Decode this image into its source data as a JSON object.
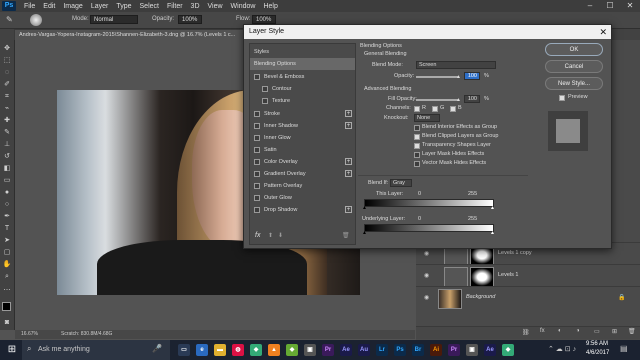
{
  "app": {
    "logo": "Ps"
  },
  "menubar": [
    "File",
    "Edit",
    "Image",
    "Layer",
    "Type",
    "Select",
    "Filter",
    "3D",
    "View",
    "Window",
    "Help"
  ],
  "options_bar": {
    "mode_label": "Mode:",
    "mode_value": "Normal",
    "opacity_label": "Opacity:",
    "opacity_value": "100%",
    "flow_label": "Flow:",
    "flow_value": "100%"
  },
  "document_tab": "Andres-Vargas-Yopera-Instagram-2015\\Shannen-Elizabeth-3.dng @ 16.7% (Levels 1 c...",
  "status": {
    "zoom": "16.67%",
    "scratch": "Scratch: 830.8M/4.68G"
  },
  "dialog": {
    "title": "Layer Style",
    "styles_header": "Styles",
    "items": [
      {
        "label": "Blending Options",
        "checkbox": false,
        "plus": false,
        "selected": true
      },
      {
        "label": "Bevel & Emboss",
        "checkbox": true,
        "plus": false
      },
      {
        "label": "Contour",
        "checkbox": true,
        "plus": false,
        "indent": true
      },
      {
        "label": "Texture",
        "checkbox": true,
        "plus": false,
        "indent": true
      },
      {
        "label": "Stroke",
        "checkbox": true,
        "plus": true
      },
      {
        "label": "Inner Shadow",
        "checkbox": true,
        "plus": true
      },
      {
        "label": "Inner Glow",
        "checkbox": true,
        "plus": false
      },
      {
        "label": "Satin",
        "checkbox": true,
        "plus": false
      },
      {
        "label": "Color Overlay",
        "checkbox": true,
        "plus": true
      },
      {
        "label": "Gradient Overlay",
        "checkbox": true,
        "plus": true
      },
      {
        "label": "Pattern Overlay",
        "checkbox": true,
        "plus": false
      },
      {
        "label": "Outer Glow",
        "checkbox": true,
        "plus": false
      },
      {
        "label": "Drop Shadow",
        "checkbox": true,
        "plus": true
      }
    ],
    "fx_label": "fx",
    "blending": {
      "heading": "Blending Options",
      "general": "General Blending",
      "blend_mode_label": "Blend Mode:",
      "blend_mode_value": "Screen",
      "opacity_label": "Opacity:",
      "opacity_value": "100",
      "opacity_unit": "%",
      "advanced": "Advanced Blending",
      "fill_opacity_label": "Fill Opacity:",
      "fill_opacity_value": "100",
      "fill_opacity_unit": "%",
      "channels_label": "Channels:",
      "channels": [
        "R",
        "G",
        "B"
      ],
      "knockout_label": "Knockout:",
      "knockout_value": "None",
      "options": [
        {
          "label": "Blend Interior Effects as Group",
          "checked": false
        },
        {
          "label": "Blend Clipped Layers as Group",
          "checked": true
        },
        {
          "label": "Transparency Shapes Layer",
          "checked": true
        },
        {
          "label": "Layer Mask Hides Effects",
          "checked": false
        },
        {
          "label": "Vector Mask Hides Effects",
          "checked": false
        }
      ],
      "blend_if_label": "Blend If:",
      "blend_if_value": "Gray",
      "this_layer_label": "This Layer:",
      "this_layer_min": "0",
      "this_layer_max": "255",
      "underlying_label": "Underlying Layer:",
      "underlying_min": "0",
      "underlying_max": "255"
    },
    "buttons": {
      "ok": "OK",
      "cancel": "Cancel",
      "new_style": "New Style...",
      "preview": "Preview"
    }
  },
  "layers": [
    {
      "name": "Levels 1 copy"
    },
    {
      "name": "Levels 1"
    },
    {
      "name": "Background"
    }
  ],
  "taskbar": {
    "search_placeholder": "Ask me anything",
    "time": "9:56 AM",
    "date": "4/6/2017"
  }
}
